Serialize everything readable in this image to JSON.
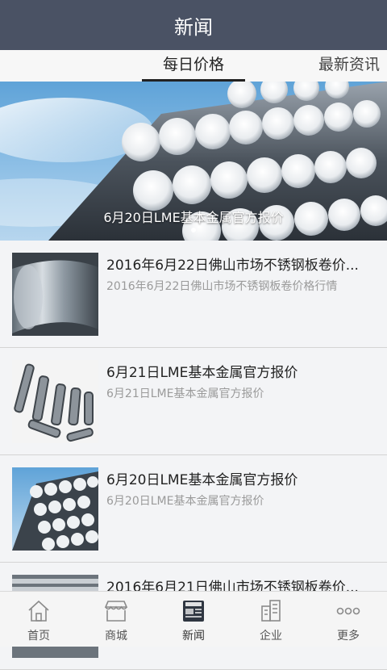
{
  "header": {
    "title": "新闻"
  },
  "tabs": [
    {
      "label": "每日价格",
      "active": true
    },
    {
      "label": "最新资讯",
      "active": false
    }
  ],
  "banner": {
    "caption": "6月20日LME基本金属官方报价",
    "image": "steel-bars-photo"
  },
  "news": [
    {
      "title": "2016年6月22日佛山市场不锈钢板卷价...",
      "summary": "2016年6月22日佛山市场不锈钢板卷价格行情",
      "thumb": "steel-coil-photo"
    },
    {
      "title": "6月21日LME基本金属官方报价",
      "summary": "6月21日LME基本金属官方报价",
      "thumb": "steel-tubes-photo"
    },
    {
      "title": "6月20日LME基本金属官方报价",
      "summary": "6月20日LME基本金属官方报价",
      "thumb": "steel-bars-photo"
    },
    {
      "title": "2016年6月21日佛山市场不锈钢板卷价...",
      "summary": "",
      "thumb": "steel-pipes-photo"
    }
  ],
  "bottom_nav": [
    {
      "label": "首页",
      "icon": "home-icon",
      "active": false
    },
    {
      "label": "商城",
      "icon": "store-icon",
      "active": false
    },
    {
      "label": "新闻",
      "icon": "news-icon",
      "active": true
    },
    {
      "label": "企业",
      "icon": "building-icon",
      "active": false
    },
    {
      "label": "更多",
      "icon": "more-icon",
      "active": false
    }
  ],
  "colors": {
    "header_bg": "#4a5264",
    "tab_indicator": "#222222"
  }
}
